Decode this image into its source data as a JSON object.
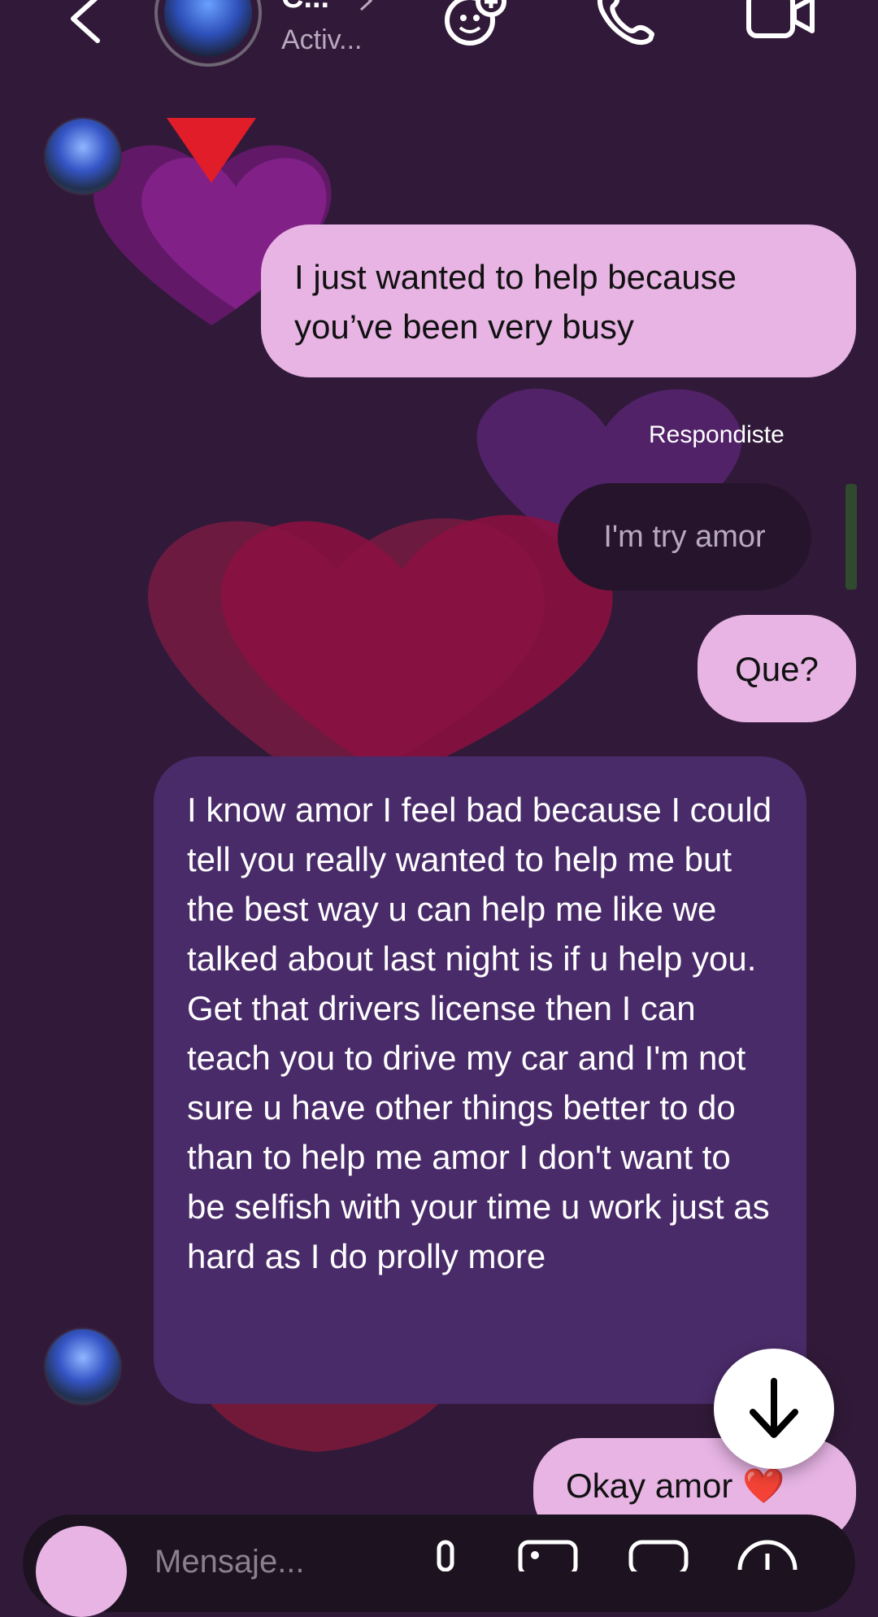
{
  "header": {
    "name": "C...",
    "status": "Activ...",
    "icons": [
      "back-chevron-icon",
      "avatar",
      "effects-icon",
      "phone-icon",
      "video-icon"
    ]
  },
  "messages": [
    {
      "dir": "out",
      "text": "I just wanted to help because you’ve been very busy"
    },
    {
      "dir": "reply_label",
      "text": "Respondiste"
    },
    {
      "dir": "reply_quote",
      "text": "I'm try amor"
    },
    {
      "dir": "out",
      "text": "Que?"
    },
    {
      "dir": "in",
      "text": "I know amor I feel bad because I could tell you really wanted to help me but the best way u can help me like we talked about last night is if u help you. Get that drivers license then I can teach you to drive my car and I'm not sure u have other things better to do than to help me amor I don't want to be selfish with your time u work just as hard as I do prolly more"
    },
    {
      "dir": "out",
      "text": "Okay amor ❤️"
    }
  ],
  "composer": {
    "placeholder": "Mensaje..."
  },
  "colors": {
    "background": "#311a39",
    "outgoing_bubble": "#e7b4e4",
    "incoming_bubble": "#4a2b6a",
    "reply_bubble": "#26142c"
  }
}
